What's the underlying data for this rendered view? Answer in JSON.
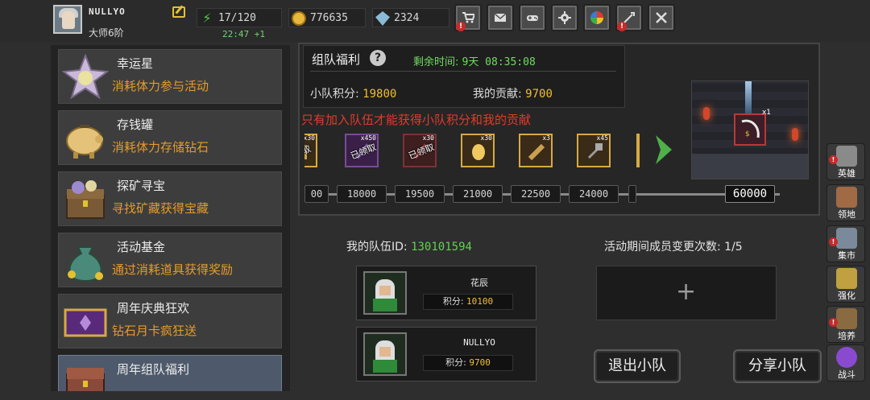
{
  "player": {
    "name": "NULLYO",
    "rank": "大师6阶",
    "stamina": "17/120",
    "stamina_timer": "22:47 +1",
    "coins": "776635",
    "gems": "2324"
  },
  "top_icons": [
    "shop-cart-icon",
    "mail-icon",
    "gamepad-icon",
    "gear-icon",
    "color-wheel-icon",
    "sparkle-icon",
    "swords-icon"
  ],
  "sidebar": {
    "items": [
      {
        "title": "幸运星",
        "desc": "消耗体力参与活动",
        "icon": "lucky-star-icon"
      },
      {
        "title": "存钱罐",
        "desc": "消耗体力存储钻石",
        "icon": "piggy-bank-icon"
      },
      {
        "title": "探矿寻宝",
        "desc": "寻找矿藏获得宝藏",
        "icon": "treasure-chest-icon"
      },
      {
        "title": "活动基金",
        "desc": "通过消耗道具获得奖励",
        "icon": "money-bag-icon"
      },
      {
        "title": "周年庆典狂欢",
        "desc": "钻石月卡疯狂送",
        "icon": "card-icon"
      },
      {
        "title": "周年组队福利",
        "desc": "",
        "icon": "chest-icon"
      }
    ]
  },
  "panel": {
    "title": "组队福利",
    "remaining_label": "剩余时间: ",
    "remaining_value": "9天 08:35:08",
    "team_score_label": "小队积分: ",
    "team_score": "19800",
    "my_contrib_label": "我的贡献: ",
    "my_contrib": "9700",
    "warning": "只有加入队伍才能获得小队积分和我的贡献"
  },
  "rewards": [
    {
      "count": "x30",
      "claimed": "领取",
      "style": "gold"
    },
    {
      "count": "x450",
      "claimed": "已领取",
      "style": "purple"
    },
    {
      "count": "x30",
      "claimed": "已领取",
      "style": "red"
    },
    {
      "count": "x30",
      "claimed": "",
      "style": "gold"
    },
    {
      "count": "x3",
      "claimed": "",
      "style": "gold"
    },
    {
      "count": "x45",
      "claimed": "",
      "style": "gold"
    }
  ],
  "thresholds": [
    "00",
    "18000",
    "19500",
    "21000",
    "22500",
    "24000",
    "60000"
  ],
  "grand_prize": {
    "count": "x1"
  },
  "team": {
    "id_label": "我的队伍ID: ",
    "id_value": "130101594",
    "changes": "活动期间成员变更次数: 1/5",
    "members": [
      {
        "name": "花辰",
        "score_label": "积分: ",
        "score": "10100"
      },
      {
        "name": "NULLYO",
        "score_label": "积分: ",
        "score": "9700"
      }
    ],
    "add_symbol": "+",
    "leave_button": "退出小队",
    "share_button": "分享小队"
  },
  "side_nav": [
    {
      "label": "英雄",
      "alert": true
    },
    {
      "label": "领地",
      "alert": false
    },
    {
      "label": "集市",
      "alert": true
    },
    {
      "label": "强化",
      "alert": false
    },
    {
      "label": "培养",
      "alert": true
    },
    {
      "label": "战斗",
      "alert": false
    }
  ],
  "colors": {
    "accent_orange": "#e59b2a",
    "score_gold": "#f0c030",
    "timer_green": "#6fdc5f",
    "warning_red": "#e23a2a"
  }
}
